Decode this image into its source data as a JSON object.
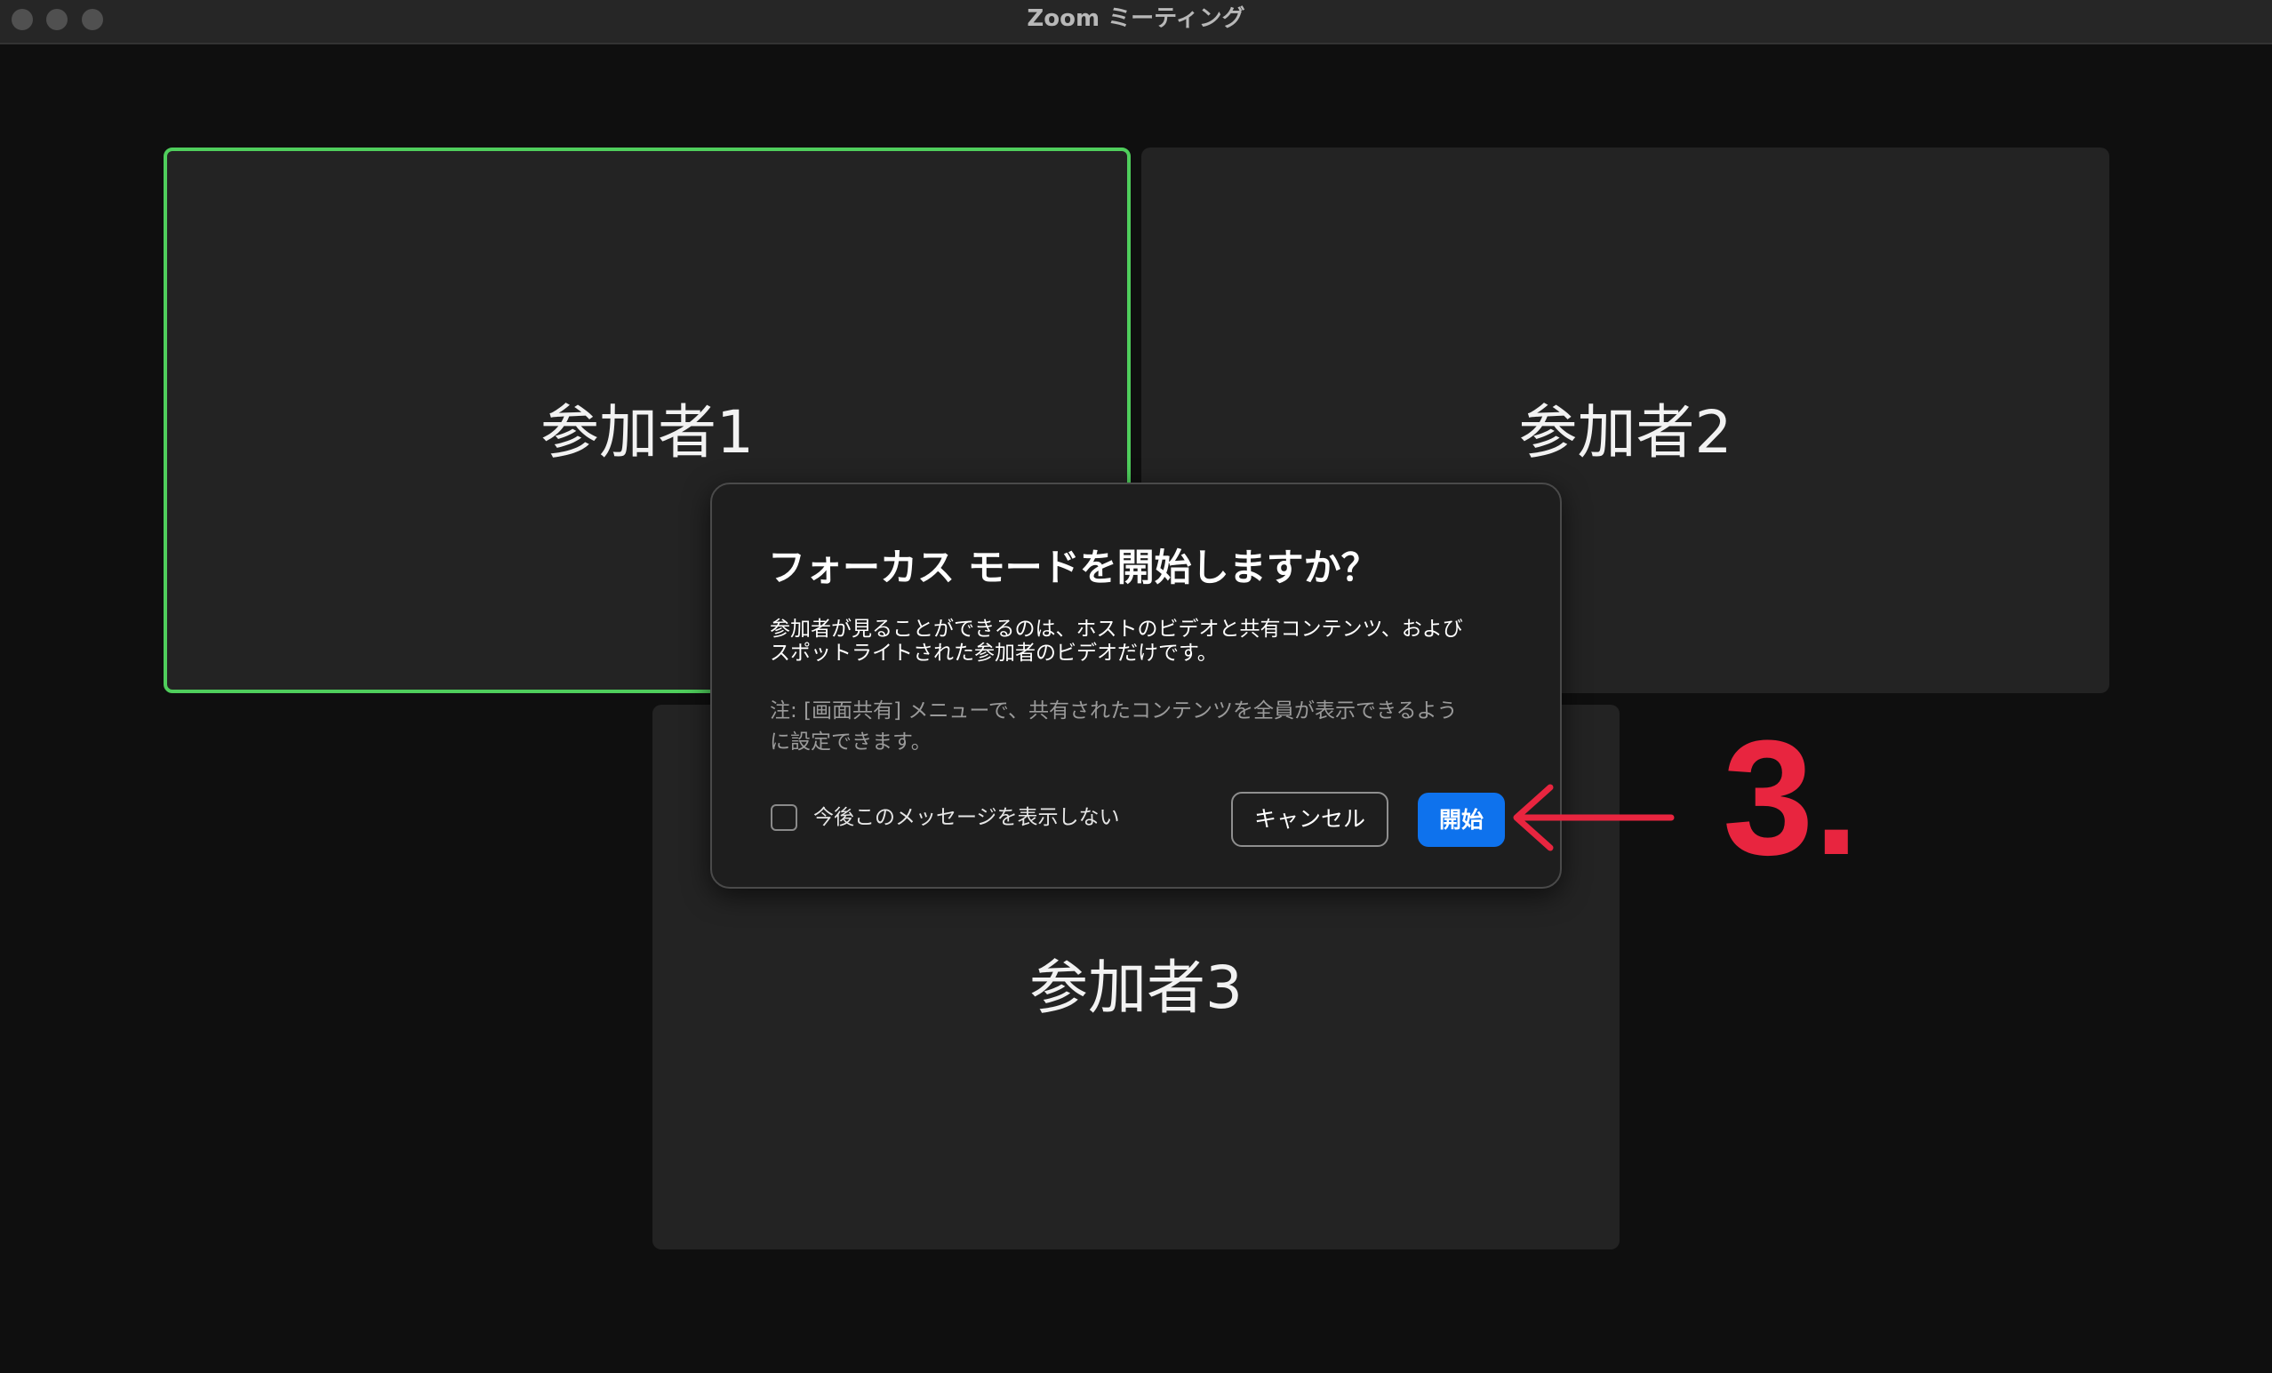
{
  "window": {
    "title": "Zoom ミーティング"
  },
  "participants": [
    {
      "name": "参加者1",
      "active": true
    },
    {
      "name": "参加者2",
      "active": false
    },
    {
      "name": "参加者3",
      "active": false
    }
  ],
  "dialog": {
    "title": "フォーカス モードを開始しますか？",
    "body": "参加者が見ることができるのは、ホストのビデオと共有コンテンツ、および\nスポットライトされた参加者のビデオだけです。",
    "note": "注: [画面共有] メニューで、共有されたコンテンツを全員が表示できるよう\nに設定できます。",
    "checkbox_label": "今後このメッセージを表示しない",
    "checkbox_checked": false,
    "cancel_label": "キャンセル",
    "start_label": "開始"
  },
  "annotation": {
    "label": "3.",
    "color": "#e8253f"
  },
  "colors": {
    "active_speaker_border": "#4fce5c",
    "primary_button": "#0e72ed"
  }
}
